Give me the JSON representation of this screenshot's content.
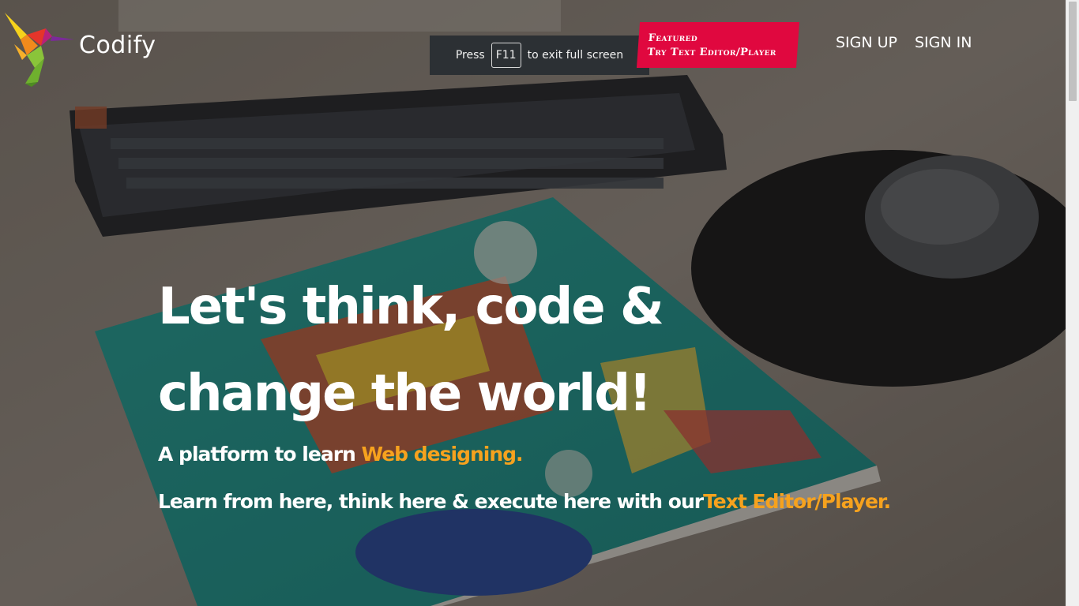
{
  "brand": {
    "name": "Codify",
    "logo_icon": "hummingbird-logo-icon"
  },
  "featured_banner": {
    "line1": "Featured",
    "line2": "Try Text Editor/Player",
    "color": "#e0083f"
  },
  "nav": {
    "signup_label": "SIGN UP",
    "signin_label": "SIGN IN"
  },
  "fullscreen_notice": {
    "before": "Press",
    "key": "F11",
    "after": "to exit full screen"
  },
  "hero": {
    "headline_line1": "Let's think, code &",
    "headline_line2": "change the world!",
    "sub1_text": "A platform to learn ",
    "sub1_highlight": "Web designing.",
    "sub2_text": "Learn from here, think here & execute here with our",
    "sub2_highlight": "Text Editor/Player.",
    "accent_color": "#f6a21e"
  }
}
